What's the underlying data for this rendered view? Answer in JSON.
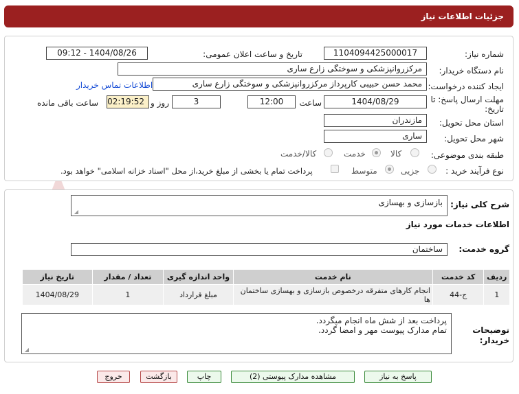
{
  "header": {
    "title": "جزئیات اطلاعات نیاز"
  },
  "form": {
    "need_number_label": "شماره نیاز:",
    "need_number": "1104094425000017",
    "announce_label": "تاریخ و ساعت اعلان عمومی:",
    "announce_value": "1404/08/26 - 09:12",
    "buyer_org_label": "نام دستگاه خریدار:",
    "buyer_org": "مرکزروانپزشکی و سوختگی زارع ساری",
    "creator_label": "ایجاد کننده درخواست:",
    "creator": "محمد حسن حبیبی کارپرداز مرکزروانپزشکی و سوختگی زارع ساری",
    "contact_link": "اطلاعات تماس خریدار",
    "deadline_label_1": "مهلت ارسال پاسخ: تا",
    "deadline_label_2": "تاریخ:",
    "deadline_date": "1404/08/29",
    "time_label": "ساعت",
    "deadline_time": "12:00",
    "days_value": "3",
    "days_label": "روز و",
    "remaining_time": "02:19:52",
    "remaining_label": "ساعت باقی مانده",
    "province_label": "استان محل تحویل:",
    "province": "مازندران",
    "city_label": "شهر محل تحویل:",
    "city": "ساری",
    "category_label": "طبقه بندی موضوعی:",
    "category_options": [
      "کالا",
      "خدمت",
      "کالا/خدمت"
    ],
    "category_selected": "خدمت",
    "process_label": "نوع فرآیند خرید :",
    "process_options": [
      "جزیی",
      "متوسط"
    ],
    "process_selected": "متوسط",
    "payment_note": "پرداخت تمام یا بخشی از مبلغ خرید،از محل \"اسناد خزانه اسلامی\" خواهد بود."
  },
  "details": {
    "summary_label": "شرح کلی نیاز:",
    "summary": "بازسازی و بهسازی",
    "services_heading": "اطلاعات خدمات مورد نیاز",
    "service_group_label": "گروه خدمت:",
    "service_group": "ساختمان"
  },
  "table": {
    "headers": [
      "ردیف",
      "کد خدمت",
      "نام خدمت",
      "واحد اندازه گیری",
      "تعداد / مقدار",
      "تاریخ نیاز"
    ],
    "rows": [
      {
        "row": "1",
        "code": "ج-44",
        "name": "انجام کارهای متفرقه درخصوص بازسازی و بهسازی ساختمان ها",
        "unit": "مبلغ قرارداد",
        "qty": "1",
        "date": "1404/08/29"
      }
    ]
  },
  "notes": {
    "label_1": "توضیحات",
    "label_2": "خریدار:",
    "line1": "پرداخت بعد از شش ماه انجام میگردد.",
    "line2": "تمام مدارک پیوست مهر و امضا گردد."
  },
  "buttons": {
    "reply": "پاسخ به نیاز",
    "attachments": "مشاهده مدارک پیوستی (2)",
    "print": "چاپ",
    "back": "بازگشت",
    "exit": "خروج"
  },
  "colors": {
    "header_bg": "#9b2020",
    "link": "#1a4fd6",
    "button_green": "#3a8a3a",
    "button_red": "#b64a4a"
  }
}
